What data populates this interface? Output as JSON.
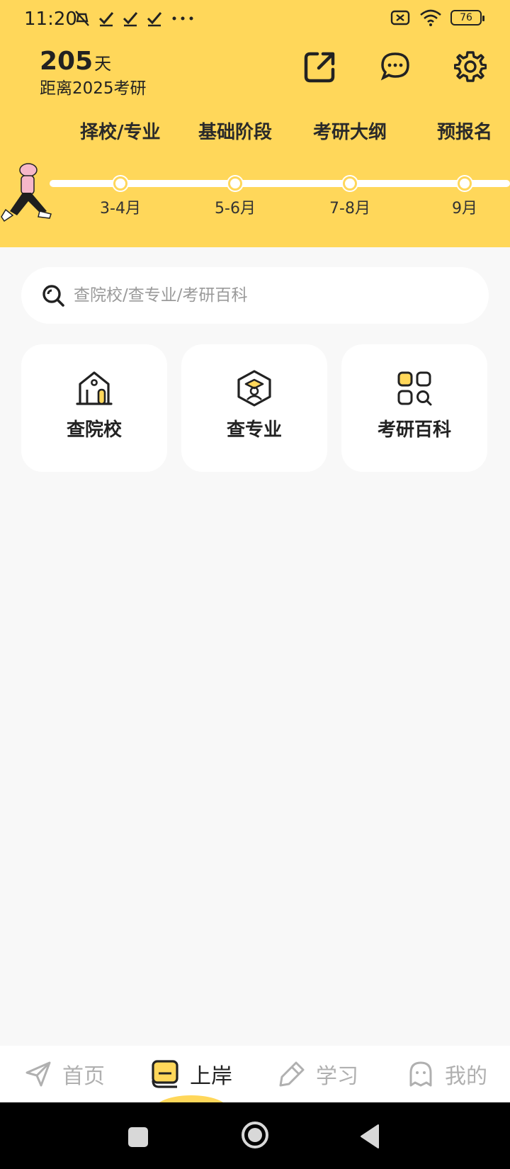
{
  "status_bar": {
    "time": "11:20",
    "battery": "76"
  },
  "countdown": {
    "number": "205",
    "unit": "天",
    "subtitle": "距离2025考研"
  },
  "phase_tabs": [
    "择校/专业",
    "基础阶段",
    "考研大纲",
    "预报名"
  ],
  "timeline": [
    "3-4月",
    "5-6月",
    "7-8月",
    "9月"
  ],
  "search": {
    "placeholder": "查院校/查专业/考研百科"
  },
  "cards": [
    {
      "label": "查院校",
      "icon": "school-building-icon"
    },
    {
      "label": "查专业",
      "icon": "graduation-cap-icon"
    },
    {
      "label": "考研百科",
      "icon": "encyclopedia-grid-icon"
    }
  ],
  "bottom_nav": [
    {
      "label": "首页",
      "icon": "paper-plane-icon",
      "active": false
    },
    {
      "label": "上岸",
      "icon": "book-icon",
      "active": true
    },
    {
      "label": "学习",
      "icon": "pen-icon",
      "active": false
    },
    {
      "label": "我的",
      "icon": "ghost-icon",
      "active": false
    }
  ],
  "colors": {
    "accent": "#ffd75a",
    "background": "#f8f8f8",
    "text": "#222222",
    "inactive": "#b0b0b0"
  }
}
